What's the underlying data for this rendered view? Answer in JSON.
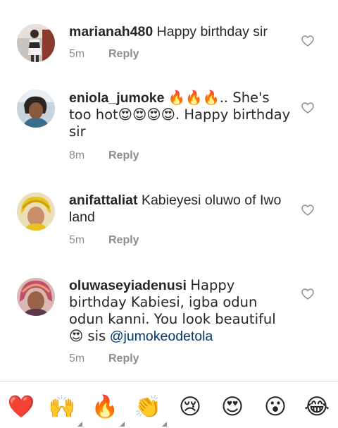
{
  "comments": [
    {
      "username": "marianah480",
      "text": "Happy birthday sir",
      "time": "5m",
      "reply": "Reply"
    },
    {
      "username": "eniola_jumoke",
      "text": "🔥🔥🔥.. She's too hot😍😍😍😍. Happy birthday sir",
      "time": "8m",
      "reply": "Reply"
    },
    {
      "username": "anifattaliat",
      "text": "Kabieyesi oluwo of Iwo land",
      "time": "5m",
      "reply": "Reply"
    },
    {
      "username": "oluwaseyiadenusi",
      "text": "Happy birthday Kabiesi, igba odun odun kanni. You look beautiful 😍 sis",
      "mention": "@jumokeodetola",
      "time": "5m",
      "reply": "Reply"
    }
  ],
  "emoji_bar": [
    {
      "glyph": "❤️",
      "icon": "red-heart-icon"
    },
    {
      "glyph": "🙌",
      "icon": "raising-hands-icon"
    },
    {
      "glyph": "🔥",
      "icon": "fire-icon"
    },
    {
      "glyph": "👏",
      "icon": "clapping-hands-icon"
    },
    {
      "glyph": "😢",
      "icon": "crying-face-icon"
    },
    {
      "glyph": "😍",
      "icon": "heart-eyes-face-icon"
    },
    {
      "glyph": "😮",
      "icon": "surprised-face-icon"
    },
    {
      "glyph": "😂",
      "icon": "tears-of-joy-face-icon"
    }
  ],
  "colors": {
    "text": "#262626",
    "meta": "#8e8e8e",
    "mention": "#00376b",
    "divider": "#dbdbdb"
  }
}
